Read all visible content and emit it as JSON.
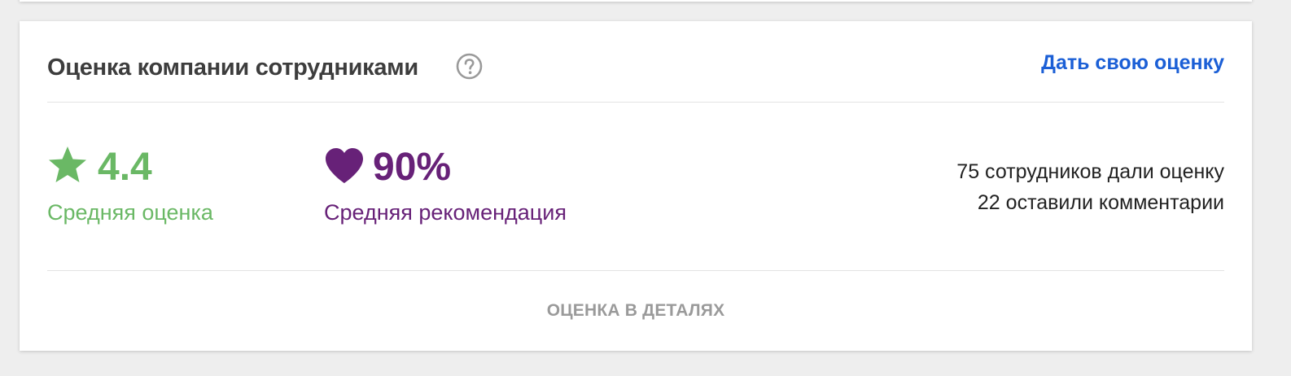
{
  "card": {
    "title": "Оценка компании сотрудниками",
    "help_icon": "question-circle-icon",
    "rate_link_label": "Дать свою оценку"
  },
  "stats": {
    "average": {
      "icon": "star-icon",
      "value": "4.4",
      "label": "Средняя оценка",
      "color": "#6ab865"
    },
    "recommendation": {
      "icon": "heart-icon",
      "value": "90%",
      "label": "Средняя рекомендация",
      "color": "#672178"
    }
  },
  "counts": {
    "rated": "75 сотрудников дали оценку",
    "commented": "22 оставили комментарии"
  },
  "footer": {
    "details_label": "ОЦЕНКА В ДЕТАЛЯХ"
  },
  "colors": {
    "link": "#1b5fd6",
    "title": "#3d3d3d",
    "muted": "#9a9a9a",
    "background": "#eeeeee"
  }
}
